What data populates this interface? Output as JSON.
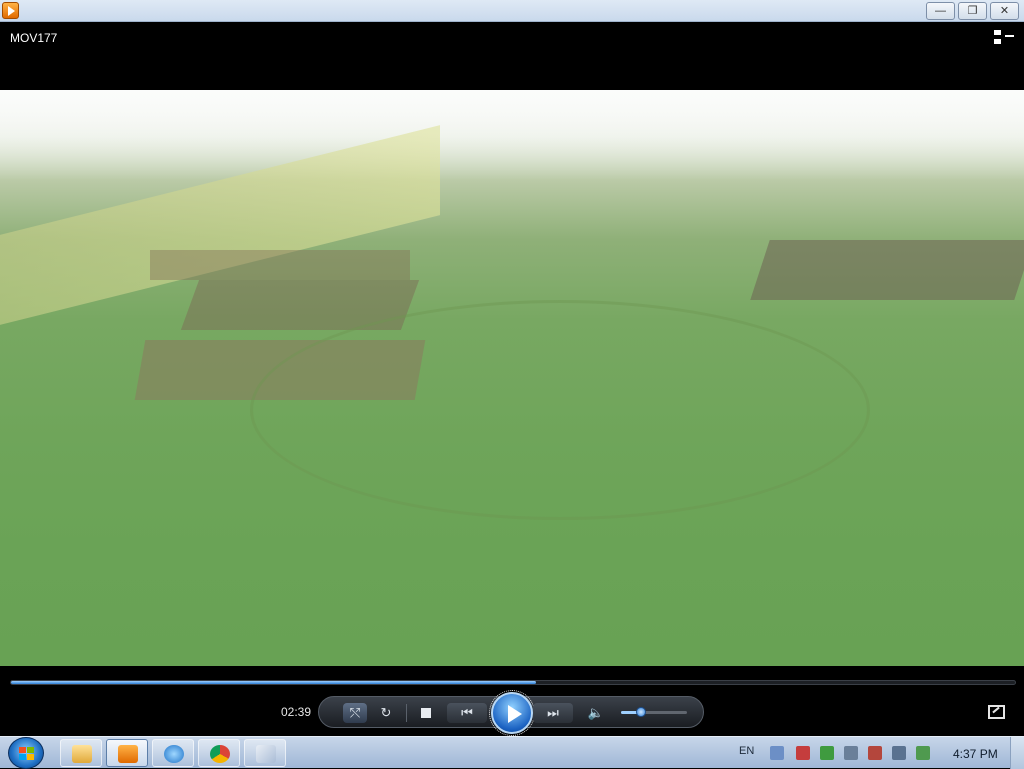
{
  "window": {
    "minimize_label": "—",
    "maximize_label": "❐",
    "close_label": "✕"
  },
  "player": {
    "title": "MOV177",
    "time": "02:39",
    "seek_progress": 0.523,
    "volume_level": 0.3
  },
  "controls": {
    "shuffle_icon": "shuffle-icon",
    "repeat_label": "↻",
    "prev_label": "⏮",
    "next_label": "⏭",
    "mute_label": "🔈"
  },
  "taskbar": {
    "language": "EN",
    "clock": "4:37 PM",
    "items": [
      "file-explorer",
      "media-player",
      "internet-explorer",
      "chrome",
      "paint"
    ]
  },
  "colors": {
    "accent": "#2d7ed6",
    "taskbar": "#b3c7e0"
  }
}
